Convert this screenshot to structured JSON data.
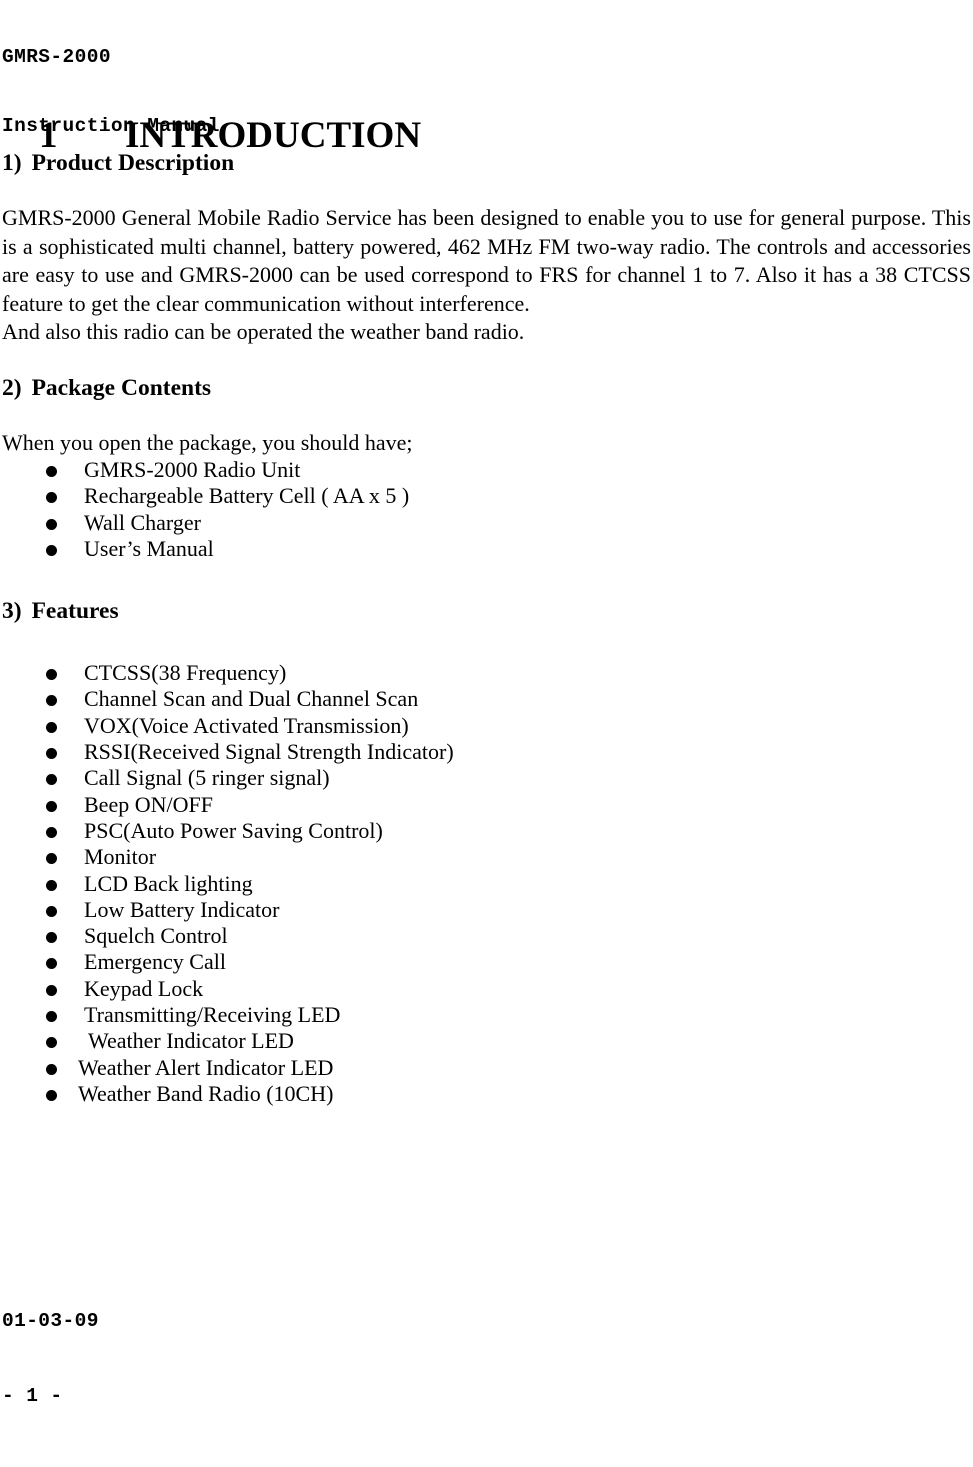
{
  "header": {
    "product": "GMRS-2000",
    "subtitle": "Instruction Manual"
  },
  "chapter": {
    "number": "1",
    "title": "INTRODUCTION"
  },
  "sections": {
    "product_description": {
      "marker": "1)",
      "heading": "Product Description",
      "paragraph": "GMRS-2000 General Mobile Radio Service has been designed to enable you to use for general purpose. This is a sophisticated multi channel, battery powered, 462 MHz FM two-way radio. The controls and accessories are easy to use and GMRS-2000 can be used correspond to FRS for channel 1 to 7. Also it has a 38 CTCSS feature to get the clear communication without interference.",
      "paragraph_extra": "And also this radio can be operated the weather band radio."
    },
    "package_contents": {
      "marker": "2)",
      "heading": "Package Contents",
      "lead_in": "When you open the package, you should have;",
      "items": [
        "GMRS-2000 Radio Unit",
        "Rechargeable Battery Cell ( AA x 5 )",
        "Wall Charger",
        "User’s Manual"
      ]
    },
    "features": {
      "marker": "3)",
      "heading": "Features",
      "items": [
        "CTCSS(38 Frequency)",
        "Channel Scan and Dual Channel Scan",
        "VOX(Voice Activated Transmission)",
        "RSSI(Received Signal Strength Indicator)",
        "Call Signal (5 ringer signal)",
        "Beep ON/OFF",
        "PSC(Auto Power Saving Control)",
        "Monitor",
        "LCD Back lighting",
        "Low Battery Indicator",
        "Squelch Control",
        "Emergency Call",
        "Keypad Lock",
        "Transmitting/Receiving LED",
        "Weather Indicator LED",
        "Weather Alert Indicator LED",
        "Weather Band Radio (10CH)"
      ]
    }
  },
  "footer": {
    "date": "01-03-09",
    "page": "- 1 -"
  },
  "colors": {
    "text": "#000000",
    "page_background": "#ffffff"
  }
}
